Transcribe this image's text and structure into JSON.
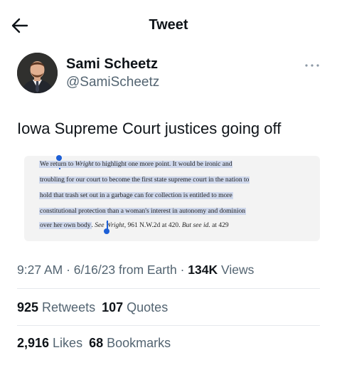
{
  "header": {
    "title": "Tweet",
    "back_icon": "arrow-left-icon"
  },
  "author": {
    "name": "Sami Scheetz",
    "handle": "@SamiScheetz",
    "more_icon": "ellipsis-icon"
  },
  "tweet": {
    "text": "Iowa Supreme Court justices going off",
    "quote": {
      "line1_a": "We return to ",
      "line1_b": "Wright",
      "line1_c": " to highlight one more point. It would be ironic and",
      "line2": "troubling for our court to become the first state supreme court in the nation to",
      "line3": "hold that trash set out in a garbage can for collection is entitled to more",
      "line4": "constitutional protection than a woman's interest in autonomy and dominion",
      "line5_a": "over her own body",
      "line5_b": ". ",
      "line5_c": "See Wright",
      "line5_d": ", 961 N.W.2d at 420. ",
      "line5_e": "But see id.",
      "line5_f": " at 429"
    }
  },
  "meta": {
    "time": "9:27 AM",
    "sep1": " · ",
    "date": "6/16/23",
    "source": " from Earth",
    "sep2": " · ",
    "views_count": "134K",
    "views_label": " Views"
  },
  "stats": {
    "retweets_count": "925",
    "retweets_label": " Retweets",
    "quotes_count": "107",
    "quotes_label": " Quotes",
    "likes_count": "2,916",
    "likes_label": " Likes",
    "bookmarks_count": "68",
    "bookmarks_label": " Bookmarks"
  },
  "colors": {
    "selection": "#cfd8ec",
    "caret": "#1d5fd6",
    "secondary_text": "#536471"
  }
}
